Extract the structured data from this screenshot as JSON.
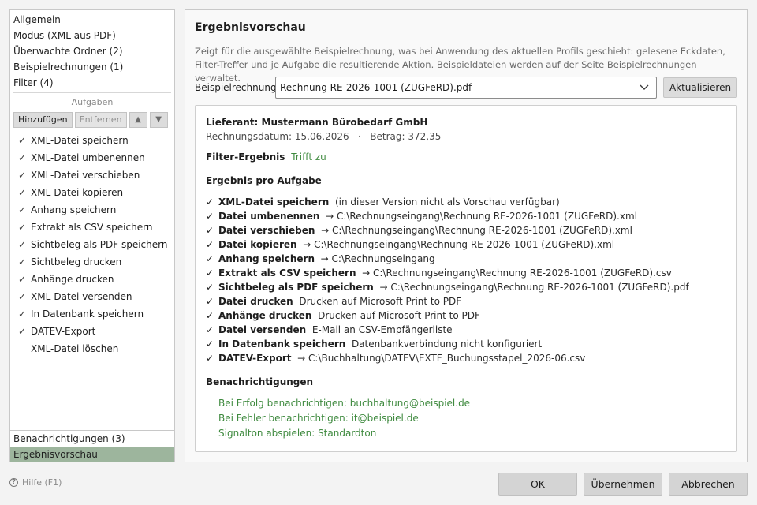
{
  "nav": {
    "items": [
      {
        "label": "Allgemein"
      },
      {
        "label": "Modus (XML aus PDF)"
      },
      {
        "label": "Überwachte Ordner (2)"
      },
      {
        "label": "Beispielrechnungen (1)"
      },
      {
        "label": "Filter (4)"
      }
    ],
    "tasks_header": "Aufgaben",
    "toolbar": {
      "add_label": "Hinzufügen",
      "remove_label": "Entfernen",
      "up_label": "▲",
      "down_label": "▼"
    },
    "tasks": [
      {
        "check": "✓",
        "label": "XML-Datei speichern"
      },
      {
        "check": "✓",
        "label": "XML-Datei umbenennen"
      },
      {
        "check": "✓",
        "label": "XML-Datei verschieben"
      },
      {
        "check": "✓",
        "label": "XML-Datei kopieren"
      },
      {
        "check": "✓",
        "label": "Anhang speichern"
      },
      {
        "check": "✓",
        "label": "Extrakt als CSV speichern"
      },
      {
        "check": "✓",
        "label": "Sichtbeleg als PDF speichern"
      },
      {
        "check": "✓",
        "label": "Sichtbeleg drucken"
      },
      {
        "check": "✓",
        "label": "Anhänge drucken"
      },
      {
        "check": "✓",
        "label": "XML-Datei versenden"
      },
      {
        "check": "✓",
        "label": "In Datenbank speichern"
      },
      {
        "check": "✓",
        "label": "DATEV-Export"
      },
      {
        "check": "",
        "label": "XML-Datei löschen"
      }
    ],
    "bottom_items": [
      {
        "label": "Benachrichtigungen (3)"
      },
      {
        "label": "Ergebnisvorschau"
      }
    ]
  },
  "preview": {
    "title": "Ergebnisvorschau",
    "description": "Zeigt für die ausgewählte Beispielrechnung, was bei Anwendung des aktuellen Profils geschieht: gelesene Eckdaten, Filter-Treffer und je Aufgabe die resultierende Aktion. Beispieldateien werden auf der Seite Beispielrechnungen verwaltet.",
    "example_label": "Beispielrechnung:",
    "example_value": "Rechnung RE-2026-1001 (ZUGFeRD).pdf",
    "refresh_label": "Aktualisieren",
    "supplier": "Lieferant: Mustermann Bürobedarf GmbH",
    "meta": "Rechnungsdatum: 15.06.2026   ·   Betrag: 372,35",
    "filter_label": "Filter-Ergebnis",
    "filter_value": "Trifft zu",
    "tasks_heading": "Ergebnis pro Aufgabe",
    "task_results": [
      {
        "check": "✓",
        "name": "XML-Datei speichern",
        "detail": "(in dieser Version nicht als Vorschau verfügbar)"
      },
      {
        "check": "✓",
        "name": "Datei umbenennen",
        "detail": "→ C:\\Rechnungseingang\\Rechnung RE-2026-1001 (ZUGFeRD).xml"
      },
      {
        "check": "✓",
        "name": "Datei verschieben",
        "detail": "→ C:\\Rechnungseingang\\Rechnung RE-2026-1001 (ZUGFeRD).xml"
      },
      {
        "check": "✓",
        "name": "Datei kopieren",
        "detail": "→ C:\\Rechnungseingang\\Rechnung RE-2026-1001 (ZUGFeRD).xml"
      },
      {
        "check": "✓",
        "name": "Anhang speichern",
        "detail": "→ C:\\Rechnungseingang"
      },
      {
        "check": "✓",
        "name": "Extrakt als CSV speichern",
        "detail": "→ C:\\Rechnungseingang\\Rechnung RE-2026-1001 (ZUGFeRD).csv"
      },
      {
        "check": "✓",
        "name": "Sichtbeleg als PDF speichern",
        "detail": "→ C:\\Rechnungseingang\\Rechnung RE-2026-1001 (ZUGFeRD).pdf"
      },
      {
        "check": "✓",
        "name": "Datei drucken",
        "detail": "Drucken auf Microsoft Print to PDF"
      },
      {
        "check": "✓",
        "name": "Anhänge drucken",
        "detail": "Drucken auf Microsoft Print to PDF"
      },
      {
        "check": "✓",
        "name": "Datei versenden",
        "detail": "E-Mail an CSV-Empfängerliste"
      },
      {
        "check": "✓",
        "name": "In Datenbank speichern",
        "detail": "Datenbankverbindung nicht konfiguriert"
      },
      {
        "check": "✓",
        "name": "DATEV-Export",
        "detail": "→ C:\\Buchhaltung\\DATEV\\EXTF_Buchungsstapel_2026-06.csv"
      }
    ],
    "notifications_heading": "Benachrichtigungen",
    "notifications": [
      "Bei Erfolg benachrichtigen: buchhaltung@beispiel.de",
      "Bei Fehler benachrichtigen: it@beispiel.de",
      "Signalton abspielen: Standardton"
    ]
  },
  "footer": {
    "help_icon_glyph": "?",
    "help_label": "Hilfe (F1)",
    "ok_label": "OK",
    "apply_label": "Übernehmen",
    "cancel_label": "Abbrechen"
  },
  "colors": {
    "selected_bg": "#9db59d",
    "green_text": "#3f8a3f"
  }
}
